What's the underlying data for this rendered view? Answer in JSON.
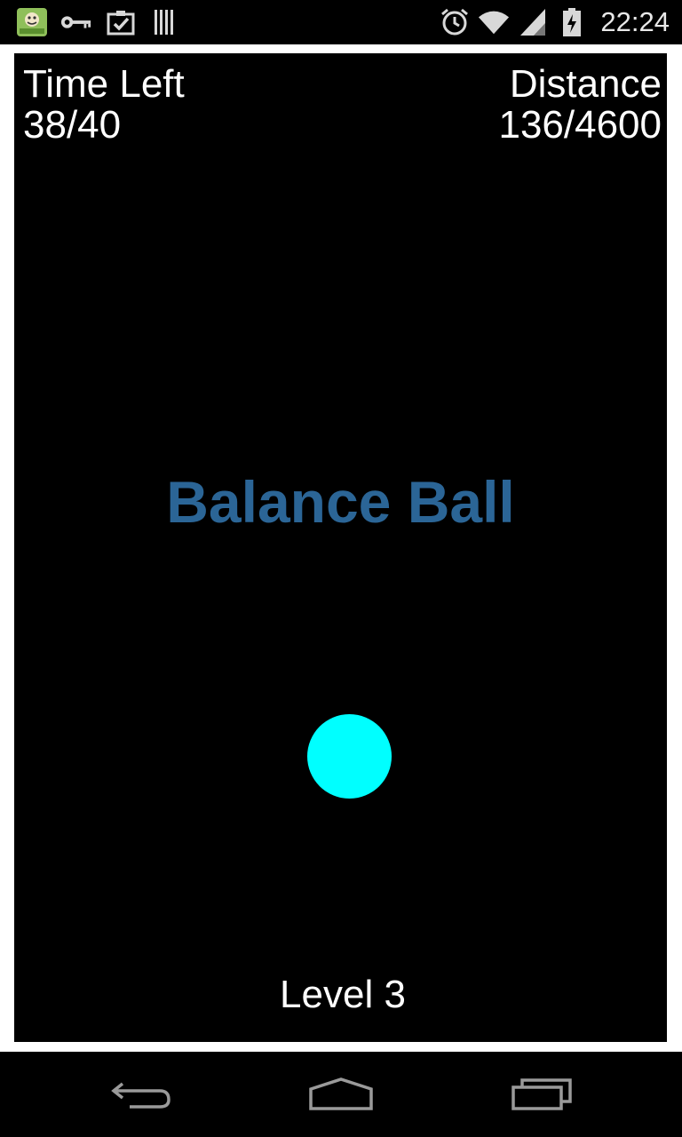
{
  "status_bar": {
    "time": "22:24",
    "left_icons": [
      "app-notification-icon",
      "key-icon",
      "clipboard-check-icon",
      "barcode-icon"
    ],
    "right_icons": [
      "alarm-icon",
      "wifi-icon",
      "signal-icon",
      "battery-charging-icon"
    ]
  },
  "hud": {
    "time_left_label": "Time Left",
    "time_left_value": "38/40",
    "distance_label": "Distance",
    "distance_value": "136/4600"
  },
  "game": {
    "title": "Balance Ball",
    "title_color": "#2b6596",
    "ball_color": "#00ffff",
    "level_label": "Level 3"
  },
  "nav_bar": {
    "buttons": [
      "back-icon",
      "home-icon",
      "recent-apps-icon"
    ]
  }
}
